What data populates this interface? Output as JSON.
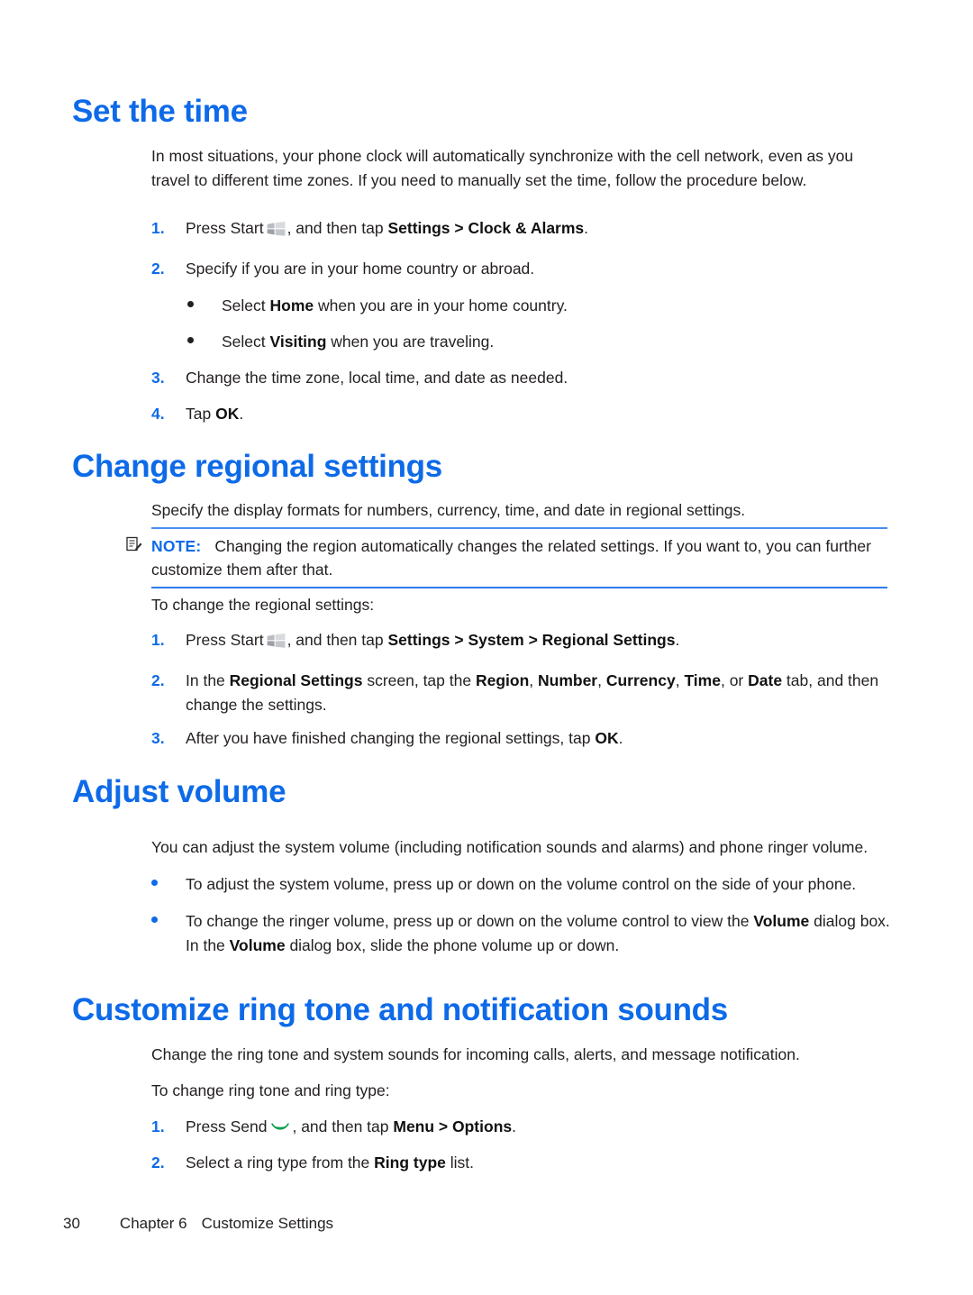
{
  "page": {
    "number": "30",
    "chapter": "Chapter 6",
    "chapter_title": "Customize Settings"
  },
  "colors": {
    "heading_blue": "#0d6ae8",
    "note_rule_blue": "#4a8ef0",
    "bullet_blue": "#0d6ae8",
    "body_black": "#231f20",
    "send_icon_green": "#0f9d4f"
  },
  "sections": {
    "set_the_time": {
      "heading": "Set the time",
      "intro": "In most situations, your phone clock will automatically synchronize with the cell network, even as you travel to different time zones. If you need to manually set the time, follow the procedure below.",
      "step1": {
        "marker": "1.",
        "pre": "Press Start",
        "icon": "windows-start-icon",
        "mid": ", and then tap ",
        "bold": "Settings > Clock & Alarms",
        "post": "."
      },
      "step2": {
        "marker": "2.",
        "text": "Specify if you are in your home country or abroad."
      },
      "sub_bullets": [
        {
          "pre": "Select ",
          "bold": "Home",
          "post": " when you are in your home country."
        },
        {
          "pre": "Select ",
          "bold": "Visiting",
          "post": " when you are traveling."
        }
      ],
      "step3": {
        "marker": "3.",
        "text": "Change the time zone, local time, and date as needed."
      },
      "step4": {
        "marker": "4.",
        "pre": "Tap ",
        "bold": "OK",
        "post": "."
      }
    },
    "change_regional_settings": {
      "heading": "Change regional settings",
      "intro": "Specify the display formats for numbers, currency, time, and date in regional settings.",
      "note": {
        "icon": "note-icon",
        "label": "NOTE:",
        "text": "Changing the region automatically changes the related settings. If you want to, you can further customize them after that."
      },
      "lead_in": "To change the regional settings:",
      "step1": {
        "marker": "1.",
        "pre": "Press Start",
        "icon": "windows-start-icon",
        "mid": ", and then tap ",
        "bold": "Settings > System > Regional Settings",
        "post": "."
      },
      "step2": {
        "marker": "2.",
        "p1": "In the ",
        "b1": "Regional Settings",
        "p2": " screen, tap the ",
        "b2": "Region",
        "p3": ", ",
        "b3": "Number",
        "p4": ", ",
        "b4": "Currency",
        "p5": ", ",
        "b5": "Time",
        "p6": ", or ",
        "b6": "Date",
        "p7": " tab, and then change the settings."
      },
      "step3": {
        "marker": "3.",
        "pre": "After you have finished changing the regional settings, tap ",
        "bold": "OK",
        "post": "."
      }
    },
    "adjust_volume": {
      "heading": "Adjust volume",
      "intro": "You can adjust the system volume (including notification sounds and alarms) and phone ringer volume.",
      "bullet1": {
        "text": "To adjust the system volume, press up or down on the volume control on the side of your phone."
      },
      "bullet2": {
        "p1": "To change the ringer volume, press up or down on the volume control to view the ",
        "b1": "Volume",
        "p2": " dialog box. In the ",
        "b2": "Volume",
        "p3": " dialog box, slide the phone volume up or down."
      }
    },
    "customize_ring_tone": {
      "heading": "Customize ring tone and notification sounds",
      "intro": "Change the ring tone and system sounds for incoming calls, alerts, and message notification.",
      "lead_in": "To change ring tone and ring type:",
      "step1": {
        "marker": "1.",
        "pre": "Press Send",
        "icon": "send-phone-icon",
        "mid": ", and then tap ",
        "bold": "Menu > Options",
        "post": "."
      },
      "step2": {
        "marker": "2.",
        "pre": "Select a ring type from the ",
        "bold": "Ring type",
        "post": " list."
      }
    }
  }
}
